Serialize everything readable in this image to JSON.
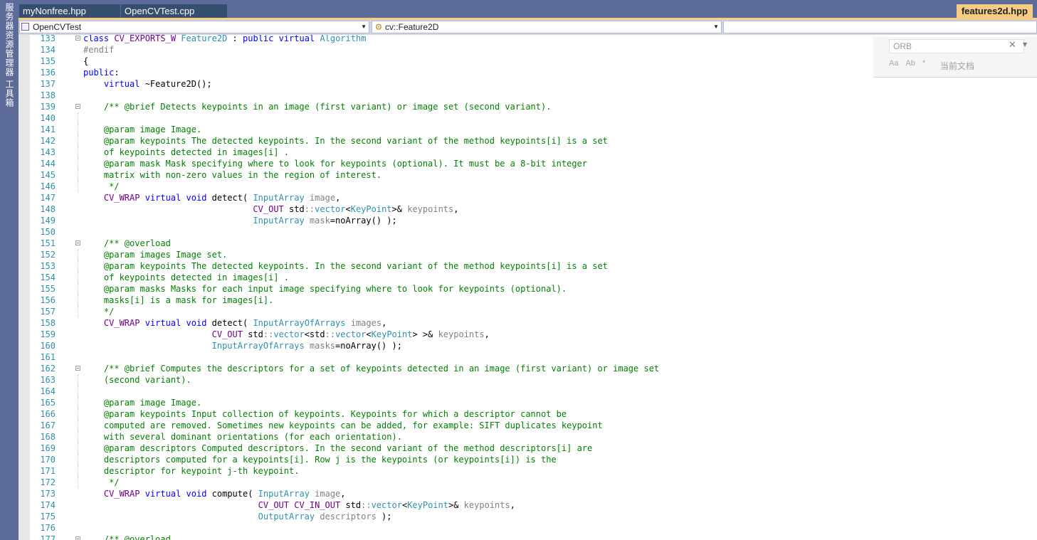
{
  "side_panel": {
    "items": [
      "服务器资源管理器",
      "工具箱"
    ]
  },
  "tabs": {
    "inactive": [
      "myNonfree.hpp",
      "OpenCVTest.cpp"
    ],
    "active": "features2d.hpp"
  },
  "navigation": {
    "project": "OpenCVTest",
    "scope": "cv::Feature2D",
    "member": ""
  },
  "find_widget": {
    "value": "ORB",
    "options": [
      "Aa",
      "Ab",
      "*"
    ],
    "scope_label": "当前文档"
  },
  "editor": {
    "lines": [
      {
        "num": "133",
        "fold": true,
        "tokens": [
          [
            "kw",
            "class "
          ],
          [
            "mac",
            "CV_EXPORTS_W"
          ],
          [
            "tx",
            " "
          ],
          [
            "ty",
            "Feature2D"
          ],
          [
            "tx",
            " : "
          ],
          [
            "kw",
            "public virtual "
          ],
          [
            "ty",
            "Algorithm"
          ]
        ]
      },
      {
        "num": "134",
        "tokens": [
          [
            "pp",
            "#endif"
          ]
        ]
      },
      {
        "num": "135",
        "tokens": [
          [
            "tx",
            "{"
          ]
        ]
      },
      {
        "num": "136",
        "tokens": [
          [
            "kw",
            "public"
          ],
          [
            "tx",
            ":"
          ]
        ]
      },
      {
        "num": "137",
        "tokens": [
          [
            "tx",
            "    "
          ],
          [
            "kw",
            "virtual"
          ],
          [
            "tx",
            " ~Feature2D();"
          ]
        ]
      },
      {
        "num": "138",
        "tokens": []
      },
      {
        "num": "139",
        "fold": true,
        "tokens": [
          [
            "cm",
            "    /** @brief Detects keypoints in an image (first variant) or image set (second variant)."
          ]
        ]
      },
      {
        "num": "140",
        "guide": true,
        "tokens": []
      },
      {
        "num": "141",
        "guide": true,
        "tokens": [
          [
            "cm",
            "    @param image Image."
          ]
        ]
      },
      {
        "num": "142",
        "guide": true,
        "tokens": [
          [
            "cm",
            "    @param keypoints The detected keypoints. In the second variant of the method keypoints[i] is a set"
          ]
        ]
      },
      {
        "num": "143",
        "guide": true,
        "tokens": [
          [
            "cm",
            "    of keypoints detected in images[i] ."
          ]
        ]
      },
      {
        "num": "144",
        "guide": true,
        "tokens": [
          [
            "cm",
            "    @param mask Mask specifying where to look for keypoints (optional). It must be a 8-bit integer"
          ]
        ]
      },
      {
        "num": "145",
        "guide": true,
        "tokens": [
          [
            "cm",
            "    matrix with non-zero values in the region of interest."
          ]
        ]
      },
      {
        "num": "146",
        "guide": true,
        "tokens": [
          [
            "cm",
            "     */"
          ]
        ]
      },
      {
        "num": "147",
        "tokens": [
          [
            "tx",
            "    "
          ],
          [
            "mac",
            "CV_WRAP"
          ],
          [
            "tx",
            " "
          ],
          [
            "kw",
            "virtual void"
          ],
          [
            "tx",
            " detect( "
          ],
          [
            "ty",
            "InputArray"
          ],
          [
            "pr",
            " image"
          ],
          [
            "tx",
            ","
          ]
        ]
      },
      {
        "num": "148",
        "tokens": [
          [
            "tx",
            "                                 "
          ],
          [
            "mac",
            "CV_OUT"
          ],
          [
            "tx",
            " std"
          ],
          [
            "pr",
            "::"
          ],
          [
            "ty",
            "vector"
          ],
          [
            "tx",
            "<"
          ],
          [
            "ty",
            "KeyPoint"
          ],
          [
            "tx",
            ">& "
          ],
          [
            "pr",
            "keypoints"
          ],
          [
            "tx",
            ","
          ]
        ]
      },
      {
        "num": "149",
        "tokens": [
          [
            "tx",
            "                                 "
          ],
          [
            "ty",
            "InputArray"
          ],
          [
            "pr",
            " mask"
          ],
          [
            "tx",
            "=noArray() );"
          ]
        ]
      },
      {
        "num": "150",
        "tokens": []
      },
      {
        "num": "151",
        "fold": true,
        "tokens": [
          [
            "cm",
            "    /** @overload"
          ]
        ]
      },
      {
        "num": "152",
        "guide": true,
        "tokens": [
          [
            "cm",
            "    @param images Image set."
          ]
        ]
      },
      {
        "num": "153",
        "guide": true,
        "tokens": [
          [
            "cm",
            "    @param keypoints The detected keypoints. In the second variant of the method keypoints[i] is a set"
          ]
        ]
      },
      {
        "num": "154",
        "guide": true,
        "tokens": [
          [
            "cm",
            "    of keypoints detected in images[i] ."
          ]
        ]
      },
      {
        "num": "155",
        "guide": true,
        "tokens": [
          [
            "cm",
            "    @param masks Masks for each input image specifying where to look for keypoints (optional)."
          ]
        ]
      },
      {
        "num": "156",
        "guide": true,
        "tokens": [
          [
            "cm",
            "    masks[i] is a mask for images[i]."
          ]
        ]
      },
      {
        "num": "157",
        "guide": true,
        "tokens": [
          [
            "cm",
            "    */"
          ]
        ]
      },
      {
        "num": "158",
        "tokens": [
          [
            "tx",
            "    "
          ],
          [
            "mac",
            "CV_WRAP"
          ],
          [
            "tx",
            " "
          ],
          [
            "kw",
            "virtual void"
          ],
          [
            "tx",
            " detect( "
          ],
          [
            "ty",
            "InputArrayOfArrays"
          ],
          [
            "pr",
            " images"
          ],
          [
            "tx",
            ","
          ]
        ]
      },
      {
        "num": "159",
        "tokens": [
          [
            "tx",
            "                         "
          ],
          [
            "mac",
            "CV_OUT"
          ],
          [
            "tx",
            " std"
          ],
          [
            "pr",
            "::"
          ],
          [
            "ty",
            "vector"
          ],
          [
            "tx",
            "<std"
          ],
          [
            "pr",
            "::"
          ],
          [
            "ty",
            "vector"
          ],
          [
            "tx",
            "<"
          ],
          [
            "ty",
            "KeyPoint"
          ],
          [
            "tx",
            "> >& "
          ],
          [
            "pr",
            "keypoints"
          ],
          [
            "tx",
            ","
          ]
        ]
      },
      {
        "num": "160",
        "tokens": [
          [
            "tx",
            "                         "
          ],
          [
            "ty",
            "InputArrayOfArrays"
          ],
          [
            "pr",
            " masks"
          ],
          [
            "tx",
            "=noArray() );"
          ]
        ]
      },
      {
        "num": "161",
        "tokens": []
      },
      {
        "num": "162",
        "fold": true,
        "tokens": [
          [
            "cm",
            "    /** @brief Computes the descriptors for a set of keypoints detected in an image (first variant) or image set"
          ]
        ]
      },
      {
        "num": "163",
        "guide": true,
        "tokens": [
          [
            "cm",
            "    (second variant)."
          ]
        ]
      },
      {
        "num": "164",
        "guide": true,
        "tokens": []
      },
      {
        "num": "165",
        "guide": true,
        "tokens": [
          [
            "cm",
            "    @param image Image."
          ]
        ]
      },
      {
        "num": "166",
        "guide": true,
        "tokens": [
          [
            "cm",
            "    @param keypoints Input collection of keypoints. Keypoints for which a descriptor cannot be"
          ]
        ]
      },
      {
        "num": "167",
        "guide": true,
        "tokens": [
          [
            "cm",
            "    computed are removed. Sometimes new keypoints can be added, for example: SIFT duplicates keypoint"
          ]
        ]
      },
      {
        "num": "168",
        "guide": true,
        "tokens": [
          [
            "cm",
            "    with several dominant orientations (for each orientation)."
          ]
        ]
      },
      {
        "num": "169",
        "guide": true,
        "tokens": [
          [
            "cm",
            "    @param descriptors Computed descriptors. In the second variant of the method descriptors[i] are"
          ]
        ]
      },
      {
        "num": "170",
        "guide": true,
        "tokens": [
          [
            "cm",
            "    descriptors computed for a keypoints[i]. Row j is the keypoints (or keypoints[i]) is the"
          ]
        ]
      },
      {
        "num": "171",
        "guide": true,
        "tokens": [
          [
            "cm",
            "    descriptor for keypoint j-th keypoint."
          ]
        ]
      },
      {
        "num": "172",
        "guide": true,
        "tokens": [
          [
            "cm",
            "     */"
          ]
        ]
      },
      {
        "num": "173",
        "tokens": [
          [
            "tx",
            "    "
          ],
          [
            "mac",
            "CV_WRAP"
          ],
          [
            "tx",
            " "
          ],
          [
            "kw",
            "virtual void"
          ],
          [
            "tx",
            " compute( "
          ],
          [
            "ty",
            "InputArray"
          ],
          [
            "pr",
            " image"
          ],
          [
            "tx",
            ","
          ]
        ]
      },
      {
        "num": "174",
        "tokens": [
          [
            "tx",
            "                                  "
          ],
          [
            "mac",
            "CV_OUT CV_IN_OUT"
          ],
          [
            "tx",
            " std"
          ],
          [
            "pr",
            "::"
          ],
          [
            "ty",
            "vector"
          ],
          [
            "tx",
            "<"
          ],
          [
            "ty",
            "KeyPoint"
          ],
          [
            "tx",
            ">& "
          ],
          [
            "pr",
            "keypoints"
          ],
          [
            "tx",
            ","
          ]
        ]
      },
      {
        "num": "175",
        "tokens": [
          [
            "tx",
            "                                  "
          ],
          [
            "ty",
            "OutputArray"
          ],
          [
            "pr",
            " descriptors"
          ],
          [
            "tx",
            " );"
          ]
        ]
      },
      {
        "num": "176",
        "tokens": []
      },
      {
        "num": "177",
        "fold": true,
        "tokens": [
          [
            "cm",
            "    /** @overload"
          ]
        ]
      }
    ]
  }
}
